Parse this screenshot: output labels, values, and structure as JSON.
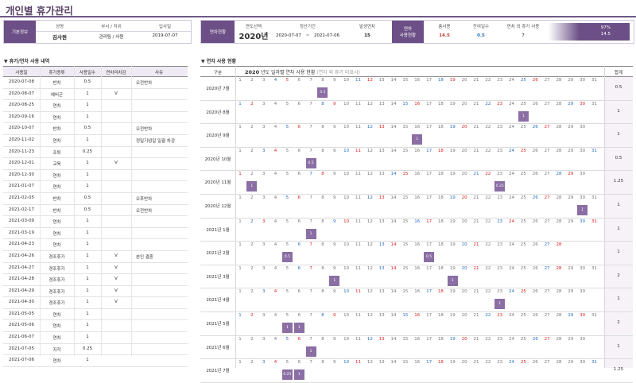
{
  "title": "개인별 휴가관리",
  "basic_info": {
    "tag": "기본정보",
    "name_label": "성명",
    "name": "김사원",
    "dept_label": "부서 / 직위",
    "dept": "관리팀 / 사원",
    "join_label": "입사일",
    "join": "2019-07-07"
  },
  "status": {
    "tag": "연차현황",
    "year_label": "연도선택",
    "year": "2020년",
    "period_label": "정산기간",
    "period_from": "2020-07-07",
    "period_sep": "~",
    "period_to": "2021-07-06",
    "granted_label": "발생연차",
    "granted": "15",
    "usage_tag": "연차\n사용현황",
    "total_used_label": "총사용",
    "total_used": "14.5",
    "remain_label": "잔여일수",
    "remain": "0.5",
    "other_label": "연차 외 휴가 사용",
    "other": "7",
    "progress_pct": "97%",
    "progress_value": "14.5",
    "progress_fraction": 0.97,
    "total_used_color": "#c0392b",
    "remain_color": "#2a6fc0"
  },
  "left_section_title": "▼ 휴가/연차 사용 내역",
  "left_columns": [
    "사용일",
    "휴가종류",
    "사용일수",
    "연차미차감",
    "사유"
  ],
  "leave_rows": [
    [
      "2020-07-08",
      "반차",
      "0.5",
      "",
      "오전반차"
    ],
    [
      "2020-08-07",
      "예비군",
      "1",
      "V",
      ""
    ],
    [
      "2020-08-25",
      "연차",
      "1",
      "",
      ""
    ],
    [
      "2020-09-16",
      "연차",
      "1",
      "",
      ""
    ],
    [
      "2020-10-07",
      "반차",
      "0.5",
      "",
      "오전반차"
    ],
    [
      "2020-11-02",
      "연차",
      "1",
      "",
      "정밀기념일 일괄 차감"
    ],
    [
      "2020-11-23",
      "조퇴",
      "0.25",
      "",
      ""
    ],
    [
      "2020-12-01",
      "교육",
      "1",
      "V",
      ""
    ],
    [
      "2020-12-30",
      "연차",
      "1",
      "",
      ""
    ],
    [
      "2021-01-07",
      "연차",
      "1",
      "",
      ""
    ],
    [
      "2021-02-05",
      "반차",
      "0.5",
      "",
      "오후반차"
    ],
    [
      "2021-02-17",
      "반차",
      "0.5",
      "",
      "오전반차"
    ],
    [
      "2021-03-09",
      "연차",
      "1",
      "",
      ""
    ],
    [
      "2021-03-19",
      "연차",
      "1",
      "",
      ""
    ],
    [
      "2021-04-23",
      "연차",
      "1",
      "",
      ""
    ],
    [
      "2021-04-26",
      "경조휴가",
      "1",
      "V",
      "본인 결혼"
    ],
    [
      "2021-04-27",
      "경조휴가",
      "1",
      "V",
      ""
    ],
    [
      "2021-04-28",
      "경조휴가",
      "1",
      "V",
      ""
    ],
    [
      "2021-04-29",
      "경조휴가",
      "1",
      "V",
      ""
    ],
    [
      "2021-04-30",
      "경조휴가",
      "1",
      "V",
      ""
    ],
    [
      "2021-05-05",
      "연차",
      "1",
      "",
      ""
    ],
    [
      "2021-05-06",
      "연차",
      "1",
      "",
      ""
    ],
    [
      "2021-06-07",
      "연차",
      "1",
      "",
      ""
    ],
    [
      "2021-07-05",
      "지각",
      "0.25",
      "",
      ""
    ],
    [
      "2021-07-06",
      "연차",
      "1",
      "",
      ""
    ]
  ],
  "right_section_title": "▼ 연차 사용 현황",
  "calendar": {
    "col_label": "구분",
    "title_year": "2020",
    "title_text": " 년도  일자별 연차 사용 현황 ",
    "title_note": "(연차 외 휴가 미표시)",
    "total_label": "합계",
    "months": [
      {
        "label": "2020년 7월",
        "total": "0.5",
        "first_dow": 3,
        "days": 31,
        "marks": [
          [
            8,
            "0.5"
          ]
        ]
      },
      {
        "label": "2020년 8월",
        "total": "1",
        "first_dow": 6,
        "days": 31,
        "marks": [
          [
            25,
            "1"
          ]
        ]
      },
      {
        "label": "2020년 9월",
        "total": "1",
        "first_dow": 2,
        "days": 30,
        "marks": [
          [
            16,
            "1"
          ]
        ]
      },
      {
        "label": "2020년 10월",
        "total": "0.5",
        "first_dow": 4,
        "days": 31,
        "marks": [
          [
            7,
            "0.5"
          ]
        ]
      },
      {
        "label": "2020년 11월",
        "total": "1.25",
        "first_dow": 0,
        "days": 30,
        "marks": [
          [
            2,
            "1"
          ],
          [
            23,
            "0.25"
          ]
        ]
      },
      {
        "label": "2020년 12월",
        "total": "1",
        "first_dow": 2,
        "days": 31,
        "marks": [
          [
            30,
            "1"
          ]
        ]
      },
      {
        "label": "2021년 1월",
        "total": "1",
        "first_dow": 5,
        "days": 31,
        "marks": [
          [
            7,
            "1"
          ]
        ]
      },
      {
        "label": "2021년 2월",
        "total": "1",
        "first_dow": 1,
        "days": 28,
        "marks": [
          [
            5,
            "0.5"
          ],
          [
            17,
            "0.5"
          ]
        ]
      },
      {
        "label": "2021년 3월",
        "total": "2",
        "first_dow": 1,
        "days": 31,
        "marks": [
          [
            9,
            "1"
          ],
          [
            19,
            "1"
          ]
        ]
      },
      {
        "label": "2021년 4월",
        "total": "1",
        "first_dow": 4,
        "days": 30,
        "marks": [
          [
            23,
            "1"
          ]
        ]
      },
      {
        "label": "2021년 5월",
        "total": "2",
        "first_dow": 6,
        "days": 31,
        "marks": [
          [
            5,
            "1"
          ],
          [
            6,
            "1"
          ]
        ]
      },
      {
        "label": "2021년 6월",
        "total": "1",
        "first_dow": 2,
        "days": 30,
        "marks": [
          [
            7,
            "1"
          ]
        ]
      },
      {
        "label": "2021년 7월",
        "total": "1.25",
        "first_dow": 4,
        "days": 31,
        "marks": [
          [
            5,
            "0.25"
          ],
          [
            6,
            "1"
          ]
        ]
      }
    ]
  },
  "colors": {
    "accent": "#6b4f86",
    "mark": "#8a6ea4",
    "saturday": "#2a6fc0",
    "sunday": "#d22222"
  }
}
